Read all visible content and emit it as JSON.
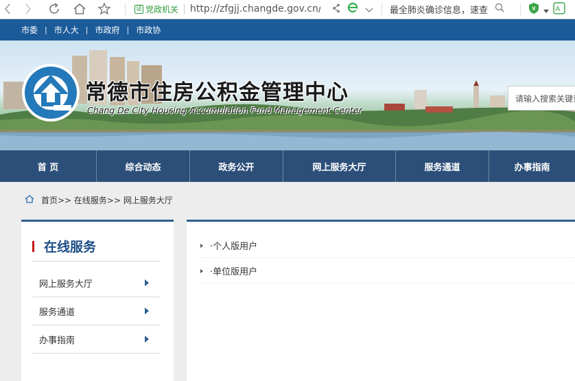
{
  "browser": {
    "cert_label": "党政机关",
    "cert_badge": "证",
    "url": "http://zfgjj.changde.gov.cn/c",
    "search_suggest": "最全肺炎确诊信息，速查"
  },
  "topbar": {
    "links": [
      "市委",
      "市人大",
      "市政府",
      "市政协"
    ],
    "separator": "|"
  },
  "banner": {
    "title": "常德市住房公积金管理中心",
    "subtitle": "Chang De City Housing Accumulation Fund Management Center",
    "search_placeholder": "请输入搜索关键词"
  },
  "main_nav": {
    "items": [
      "首 页",
      "综合动态",
      "政务公开",
      "网上服务大厅",
      "服务通道",
      "办事指南"
    ]
  },
  "breadcrumb": {
    "text": "首页>> 在线服务>> 网上服务大厅"
  },
  "sidebar": {
    "title": "在线服务",
    "items": [
      "网上服务大厅",
      "服务通道",
      "办事指南"
    ]
  },
  "content": {
    "items": [
      "·个人版用户",
      "·单位版用户"
    ]
  },
  "colors": {
    "topbar": "#1c5b9a",
    "nav": "#2c4f79",
    "accent_red": "#c4161c",
    "title_blue": "#1d4f86"
  }
}
